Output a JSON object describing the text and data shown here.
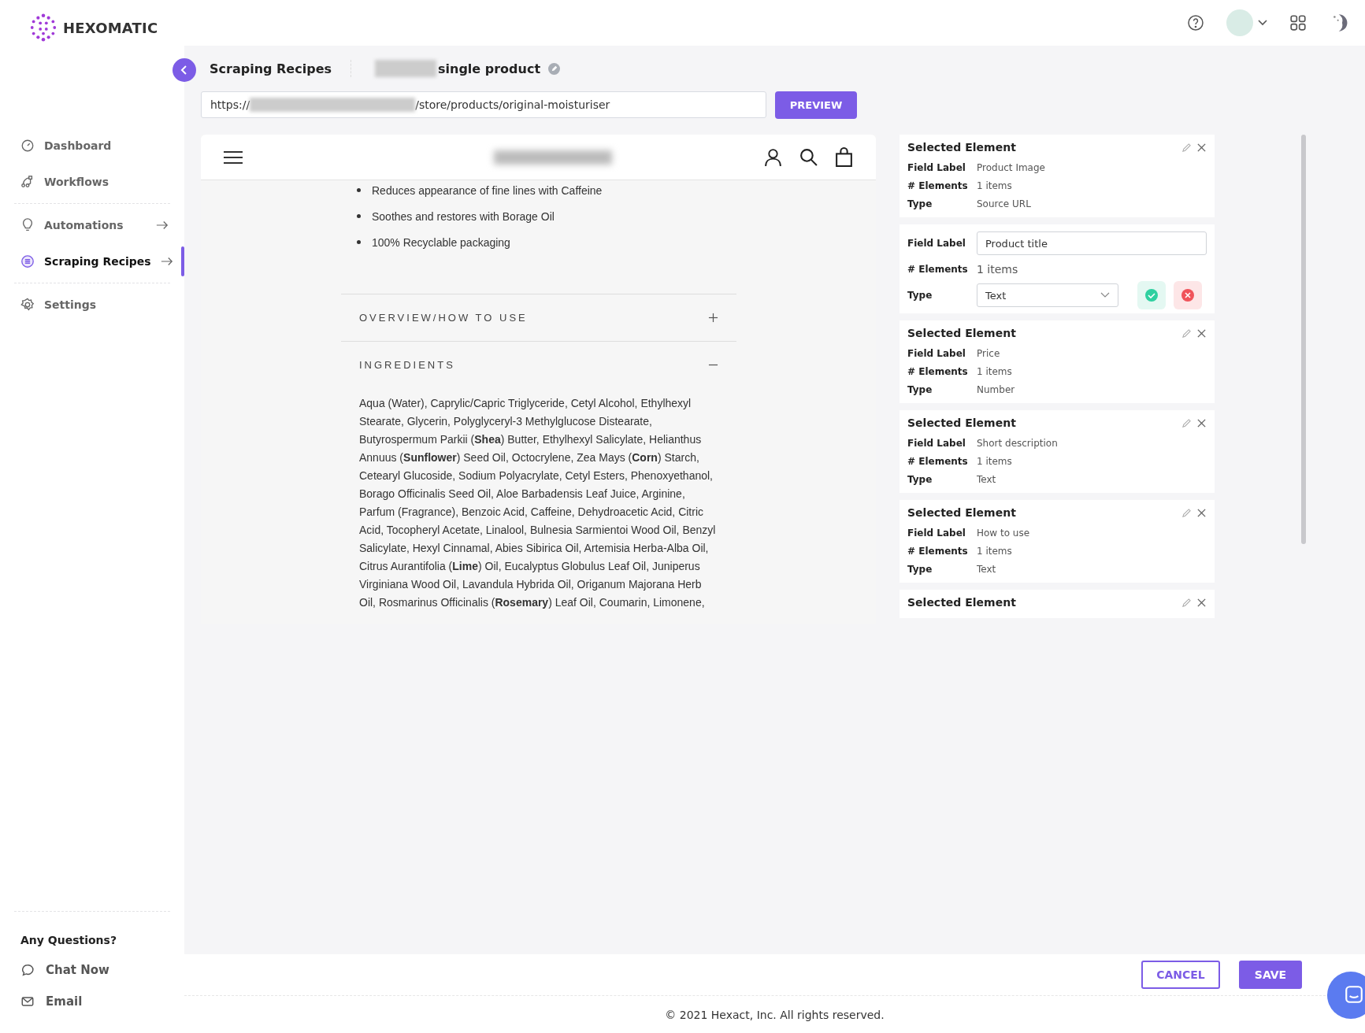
{
  "brand": {
    "name": "HEXOMATIC"
  },
  "sidebar": {
    "items": [
      {
        "label": "Dashboard",
        "selected": false,
        "has_arrow": false,
        "divider_after": false
      },
      {
        "label": "Workflows",
        "selected": false,
        "has_arrow": false,
        "divider_after": true
      },
      {
        "label": "Automations",
        "selected": false,
        "has_arrow": true,
        "divider_after": false
      },
      {
        "label": "Scraping Recipes",
        "selected": true,
        "has_arrow": true,
        "divider_after": true
      },
      {
        "label": "Settings",
        "selected": false,
        "has_arrow": false,
        "divider_after": false
      }
    ],
    "help": {
      "title": "Any Questions?",
      "links": [
        {
          "label": "Chat Now"
        },
        {
          "label": "Email"
        }
      ]
    }
  },
  "breadcrumb": {
    "section": "Scraping Recipes",
    "recipe_name": "single product"
  },
  "url_field": {
    "prefix": "https://",
    "suffix": "/store/products/original-moisturiser"
  },
  "preview_button": "PREVIEW",
  "preview": {
    "bullets": [
      "Reduces appearance of fine lines with Caffeine",
      "Soothes and restores with Borage Oil",
      "100% Recyclable packaging"
    ],
    "accordions": [
      {
        "title": "OVERVIEW/HOW TO USE",
        "expanded": false
      },
      {
        "title": "INGREDIENTS",
        "expanded": true,
        "body": "Aqua (Water), Caprylic/Capric Triglyceride, Cetyl Alcohol, Ethylhexyl Stearate, Glycerin, Polyglyceryl-3 Methylglucose Distearate, Butyrospermum Parkii (**Shea**) Butter, Ethylhexyl Salicylate, Helianthus Annuus (**Sunflower**) Seed Oil, Octocrylene, Zea Mays (**Corn**) Starch, Cetearyl Glucoside, Sodium Polyacrylate, Cetyl Esters, Phenoxyethanol, Borago Officinalis Seed Oil, Aloe Barbadensis Leaf Juice, Arginine, Parfum (Fragrance), Benzoic Acid, Caffeine, Dehydroacetic Acid, Citric Acid, Tocopheryl Acetate, Linalool, Bulnesia Sarmientoi Wood Oil, Benzyl Salicylate, Hexyl Cinnamal, Abies Sibirica Oil, Artemisia Herba-Alba Oil, Citrus Aurantifolia (**Lime**) Oil, Eucalyptus Globulus Leaf Oil, Juniperus Virginiana Wood Oil, Lavandula Hybrida Oil, Origanum Majorana Herb Oil, Rosmarinus Officinalis (**Rosemary**) Leaf Oil, Coumarin, Limonene,"
      }
    ]
  },
  "selected_elements": [
    {
      "kind": "display",
      "title": "Selected Element",
      "rows": [
        {
          "label": "Field Label",
          "value": "Product Image"
        },
        {
          "label": "# Elements",
          "value": "1 items"
        },
        {
          "label": "Type",
          "value": "Source URL"
        }
      ]
    },
    {
      "kind": "edit",
      "rows": [
        {
          "label": "Field Label",
          "value": "Product title"
        },
        {
          "label": "# Elements",
          "value": "1 items"
        },
        {
          "label": "Type",
          "value": "Text"
        }
      ]
    },
    {
      "kind": "display",
      "title": "Selected Element",
      "rows": [
        {
          "label": "Field Label",
          "value": "Price"
        },
        {
          "label": "# Elements",
          "value": "1 items"
        },
        {
          "label": "Type",
          "value": "Number"
        }
      ]
    },
    {
      "kind": "display",
      "title": "Selected Element",
      "rows": [
        {
          "label": "Field Label",
          "value": "Short description"
        },
        {
          "label": "# Elements",
          "value": "1 items"
        },
        {
          "label": "Type",
          "value": "Text"
        }
      ]
    },
    {
      "kind": "display",
      "title": "Selected Element",
      "rows": [
        {
          "label": "Field Label",
          "value": "How to use"
        },
        {
          "label": "# Elements",
          "value": "1 items"
        },
        {
          "label": "Type",
          "value": "Text"
        }
      ]
    },
    {
      "kind": "display",
      "title": "Selected Element"
    }
  ],
  "actions": {
    "cancel": "CANCEL",
    "save": "SAVE"
  },
  "footer": "© 2021 Hexact, Inc. All rights reserved."
}
